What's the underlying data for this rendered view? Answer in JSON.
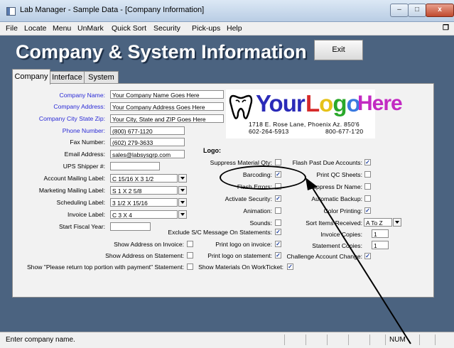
{
  "window": {
    "title": "Lab Manager - Sample Data - [Company Information]",
    "buttons": {
      "minimize": "–",
      "maximize": "□",
      "close": "x"
    }
  },
  "menu": [
    "File",
    "Locate",
    "Menu",
    "UnMark",
    "Quick Sort",
    "Security",
    "Pick-ups",
    "Help"
  ],
  "header": {
    "title": "Company & System Information",
    "exit_label": "Exit"
  },
  "tabs": [
    "Company",
    "Interface",
    "System"
  ],
  "fields": [
    {
      "label": "Company Name:",
      "value": "Your Company Name Goes Here"
    },
    {
      "label": "Company Address:",
      "value": "Your Company Address Goes Here"
    },
    {
      "label": "Company City State Zip:",
      "value": "Your City, State and ZIP Goes Here"
    },
    {
      "label": "Phone Number:",
      "value": "(800) 677-1120"
    },
    {
      "label": "Fax Number:",
      "value": "(602) 279-3633"
    },
    {
      "label": "Email Address:",
      "value": "sales@labsysgrp.com"
    },
    {
      "label": "UPS Shipper #:",
      "value": ""
    },
    {
      "label": "Account Mailing Label:",
      "value": "C 15/16 X 3 1/2"
    },
    {
      "label": "Marketing Mailing Label:",
      "value": "S 1 X 2 5/8"
    },
    {
      "label": "Scheduling Label:",
      "value": "3 1/2 X 15/16"
    },
    {
      "label": "Invoice Label:",
      "value": "C 3 X 4"
    },
    {
      "label": "Start Fiscal Year:",
      "value": ""
    }
  ],
  "logo": {
    "words": [
      "Your",
      "Logo",
      "Here"
    ],
    "colors": {
      "your": "#2a2ab8",
      "l": "#d62a2a",
      "o1": "#e6c21a",
      "g": "#2aa82a",
      "o2": "#3a7ae0",
      "here": "#c22ac2"
    },
    "address": "1718 E. Rose Lane, Phoenix Az. 850'6",
    "phone1": "602-264-5913",
    "phone2": "800-677-1'20",
    "label": "Logo:"
  },
  "checks_mid": [
    {
      "label": "Suppress Material Qty:",
      "checked": false
    },
    {
      "label": "Barcoding:",
      "checked": true
    },
    {
      "label": "Flash Errors:",
      "checked": false
    },
    {
      "label": "Activate Security:",
      "checked": true
    },
    {
      "label": "Animation:",
      "checked": false
    },
    {
      "label": "Sounds:",
      "checked": false
    },
    {
      "label": "Exclude S/C Message On Statements:",
      "checked": true
    },
    {
      "label": "Print logo on invoice:",
      "checked": true
    },
    {
      "label": "Print logo on statement:",
      "checked": true
    }
  ],
  "checks_right": [
    {
      "label": "Flash Past Due Accounts:",
      "checked": true
    },
    {
      "label": "Print QC Sheets:",
      "checked": false
    },
    {
      "label": "Suppress Dr Name:",
      "checked": false
    },
    {
      "label": "Automatic Backup:",
      "checked": false
    },
    {
      "label": "Color Printing:",
      "checked": true
    }
  ],
  "sort_items": {
    "label": "Sort Items Received:",
    "value": "A To Z"
  },
  "invoice_copies": {
    "label": "Invoice Copies:",
    "value": "1"
  },
  "statement_copies": {
    "label": "Statement Copies:",
    "value": "1"
  },
  "challenge": {
    "label": "Challenge Account Change:",
    "checked": true
  },
  "checks_bottom": [
    {
      "label": "Show Address on Invoice:",
      "checked": false
    },
    {
      "label": "Show Address on Statement:",
      "checked": false
    },
    {
      "label": "Show \"Please return top portion with payment\" Statement:",
      "checked": false
    },
    {
      "label": "Show Materials On WorkTicket:",
      "checked": true
    }
  ],
  "status": {
    "text": "Enter company name.",
    "num": "NUM"
  },
  "colors": {
    "background": "#4b6380",
    "blue_label": "#2a2ad6"
  }
}
